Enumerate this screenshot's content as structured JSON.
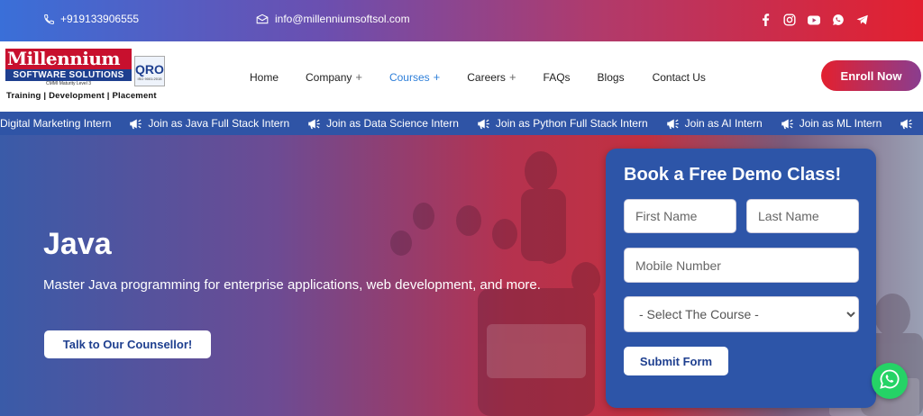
{
  "topbar": {
    "phone": "+919133906555",
    "email": "info@millenniumsoftsol.com",
    "socials": [
      "facebook-icon",
      "instagram-icon",
      "youtube-icon",
      "whatsapp-icon",
      "telegram-icon"
    ]
  },
  "logo": {
    "brand": "Millennium",
    "sub": "SOFTWARE SOLUTIONS",
    "cmmi": "CMMI Maturity Level 3",
    "tagline": "Training | Development | Placement",
    "iso_mark": "QRO",
    "iso_text": "ISO 9001:2015"
  },
  "nav": {
    "items": [
      {
        "label": "Home",
        "has_plus": false
      },
      {
        "label": "Company",
        "has_plus": true
      },
      {
        "label": "Courses",
        "has_plus": true,
        "active": true
      },
      {
        "label": "Careers",
        "has_plus": true
      },
      {
        "label": "FAQs",
        "has_plus": false
      },
      {
        "label": "Blogs",
        "has_plus": false
      },
      {
        "label": "Contact Us",
        "has_plus": false
      }
    ],
    "plus": "+",
    "enroll_label": "Enroll Now"
  },
  "ticker": {
    "items": [
      "Digital Marketing Intern",
      "Join as Java Full Stack Intern",
      "Join as Data Science Intern",
      "Join as Python Full Stack Intern",
      "Join as AI Intern",
      "Join as ML Intern"
    ]
  },
  "hero": {
    "title": "Java",
    "description": "Master Java programming for enterprise applications, web development, and more.",
    "counsel_label": "Talk to Our Counsellor!"
  },
  "form": {
    "title": "Book a Free Demo Class!",
    "first_name_placeholder": "First Name",
    "last_name_placeholder": "Last Name",
    "mobile_placeholder": "Mobile Number",
    "course_selected": "- Select The Course -",
    "submit_label": "Submit Form"
  },
  "colors": {
    "accent_blue": "#2d55a8",
    "accent_red": "#e3202f",
    "whatsapp_green": "#25d366",
    "active_link": "#2e7fd9"
  }
}
